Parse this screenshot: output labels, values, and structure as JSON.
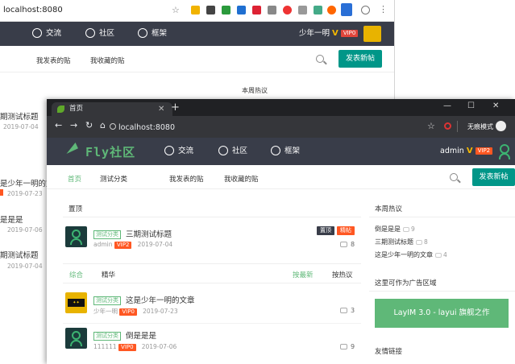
{
  "bg": {
    "url": "localhost:8080",
    "nav": {
      "items": [
        "交流",
        "社区",
        "框架"
      ],
      "user": "少年一明",
      "vip": "VIP0"
    },
    "sub": {
      "my_posts": "我发表的贴",
      "my_favs": "我收藏的贴",
      "new_post": "发表新帖"
    },
    "hot_title": "本周热议",
    "list": [
      {
        "title": "期测试标题",
        "date": "2019-07-04"
      },
      {
        "title": "是少年一明的文",
        "date": "2019-07-23"
      },
      {
        "title": "是是是",
        "date": "2019-07-06"
      },
      {
        "title": "期测试标题",
        "date": "2019-07-04"
      }
    ]
  },
  "fg": {
    "tab": {
      "title": "首页"
    },
    "url": "localhost:8080",
    "incognito": "无痕模式",
    "nav": {
      "logo": "Fly社区",
      "items": [
        "交流",
        "社区",
        "框架"
      ],
      "user": "admin",
      "vip": "VIP2"
    },
    "sub": {
      "home": "首页",
      "test_cat": "测试分类",
      "my_posts": "我发表的贴",
      "my_favs": "我收藏的贴",
      "new_post": "发表新帖"
    },
    "top_section": "置顶",
    "top_post": {
      "cat": "测试分类",
      "title": "三期测试标题",
      "author": "admin",
      "vip": "VIP2",
      "date": "2019-07-04",
      "tag1": "置顶",
      "tag2": "精帖",
      "comments": "8"
    },
    "filters": {
      "all": "综合",
      "best": "精华",
      "by_new": "按最新",
      "by_hot": "按热议"
    },
    "posts": [
      {
        "cat": "测试分类",
        "title": "这是少年一明的文章",
        "author": "少年一明",
        "vip": "VIP0",
        "date": "2019-07-23",
        "comments": "3"
      },
      {
        "cat": "测试分类",
        "title": "倒是是是",
        "author": "111111",
        "vip": "VIP0",
        "date": "2019-07-06",
        "comments": "9"
      }
    ],
    "side": {
      "hot_title": "本周热议",
      "hot": [
        {
          "title": "倒是是是",
          "count": "9"
        },
        {
          "title": "三期测试标题",
          "count": "8"
        },
        {
          "title": "这是少年一明的文章",
          "count": "4"
        }
      ],
      "ad_title": "这里可作为广告区域",
      "ad_text": "LayIM 3.0 - layui 旗舰之作",
      "links_title": "友情链接"
    }
  },
  "colors": {
    "nav_bg": "#393d49",
    "green": "#009688",
    "fly_green": "#5fb878",
    "vip": "#ff5722"
  }
}
